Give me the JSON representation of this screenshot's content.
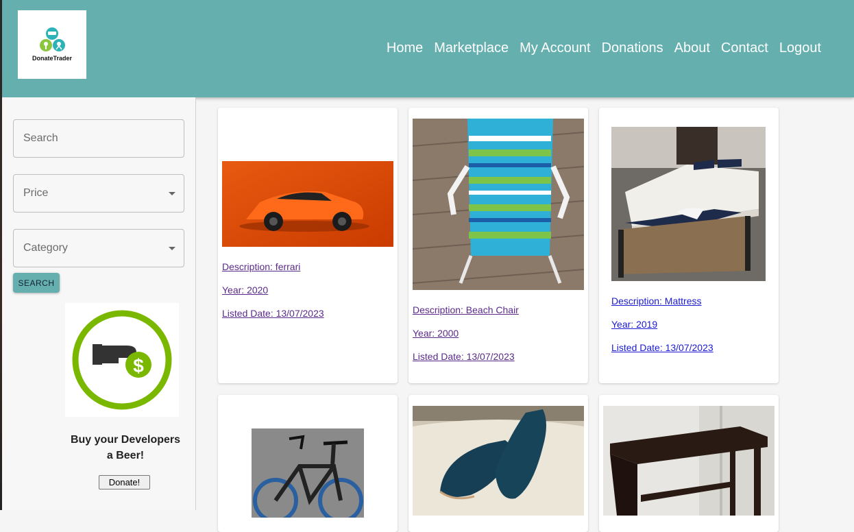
{
  "header": {
    "logo_text": "DonateTrader",
    "nav": [
      "Home",
      "Marketplace",
      "My Account",
      "Donations",
      "About",
      "Contact",
      "Logout"
    ]
  },
  "sidebar": {
    "search_placeholder": "Search",
    "price_placeholder": "Price",
    "category_placeholder": "Category",
    "search_button": "SEARCH",
    "promo_text_line1": "Buy your Developers",
    "promo_text_line2": "a Beer!",
    "donate_button": "Donate!"
  },
  "colors": {
    "header_bg": "#66afaf",
    "visited_link": "#5a2a8a",
    "unvisited_link": "#1a1ad0",
    "donate_ring": "#7ab800"
  },
  "listings": [
    {
      "description": "Description: ferrari",
      "year": "Year: 2020",
      "listed": "Listed Date: 13/07/2023",
      "image": "orange-sports-car"
    },
    {
      "description": "Description: Beach Chair",
      "year": "Year: 2000",
      "listed": "Listed Date: 13/07/2023",
      "image": "striped-beach-chair"
    },
    {
      "description": "Description: Mattress",
      "year": "Year: 2019",
      "listed": "Listed Date: 13/07/2023",
      "image": "bed-mattress"
    },
    {
      "image": "electric-bicycle"
    },
    {
      "image": "blue-suede-shoes"
    },
    {
      "image": "dark-wood-console-table"
    }
  ]
}
